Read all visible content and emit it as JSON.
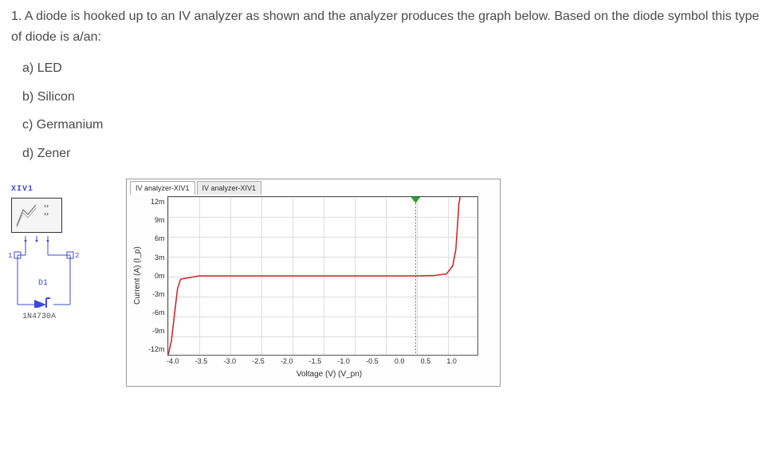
{
  "question": {
    "number": "1.",
    "text": "A diode is hooked up to an IV analyzer as shown and the analyzer produces the graph below. Based on the diode symbol this type of diode is a/an:",
    "options": [
      {
        "letter": "a)",
        "text": "LED"
      },
      {
        "letter": "b)",
        "text": "Silicon"
      },
      {
        "letter": "c)",
        "text": "Germanium"
      },
      {
        "letter": "d)",
        "text": "Zener"
      }
    ]
  },
  "schematic": {
    "instrument_ref": "XIV1",
    "pin1": "1",
    "pin2": "2",
    "component_ref": "D1",
    "part_number": "1N4730A"
  },
  "chart_panel": {
    "tab_active": "IV analyzer-XIV1",
    "tab_other": "IV analyzer-XIV1"
  },
  "chart_data": {
    "type": "line",
    "title": "",
    "xlabel": "Voltage (V) (V_pn)",
    "ylabel": "Current (A) (I_p)",
    "xlim": [
      -4.0,
      1.0
    ],
    "ylim": [
      -0.012,
      0.012
    ],
    "x_ticks": [
      "-4.0",
      "-3.5",
      "-3.0",
      "-2.5",
      "-2.0",
      "-1.5",
      "-1.0",
      "-0.5",
      "0.0",
      "0.5",
      "1.0"
    ],
    "y_ticks": [
      "12m",
      "9m",
      "6m",
      "3m",
      "0m",
      "-3m",
      "-6m",
      "-9m",
      "-12m"
    ],
    "series": [
      {
        "name": "I_p",
        "color": "#d02a2a",
        "x": [
          -4.0,
          -3.95,
          -3.9,
          -3.85,
          -3.8,
          -3.5,
          -3.0,
          -2.0,
          -1.0,
          0.0,
          0.3,
          0.5,
          0.6,
          0.65,
          0.68,
          0.7,
          0.72
        ],
        "y": [
          -0.012,
          -0.01,
          -0.006,
          -0.002,
          -0.0005,
          0.0,
          0.0,
          0.0,
          0.0,
          0.0,
          5e-05,
          0.0003,
          0.0015,
          0.004,
          0.008,
          0.011,
          0.012
        ]
      }
    ],
    "markers": [
      {
        "type": "cursor",
        "axis": "x",
        "value": 0.0,
        "color": "#2aa12a"
      }
    ]
  }
}
